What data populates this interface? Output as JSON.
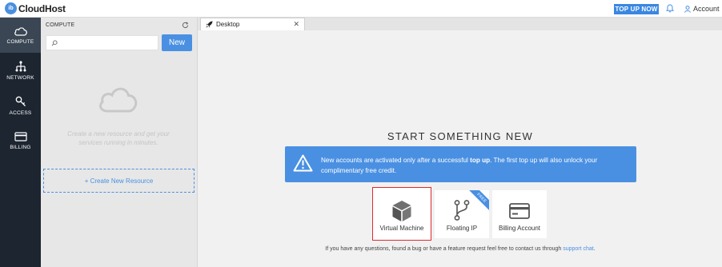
{
  "app": {
    "logo_mark": "ib",
    "name": "CloudHost"
  },
  "header": {
    "topup_label": "TOP UP NOW",
    "account_label": "Account",
    "icons": [
      "bell-icon",
      "user-icon"
    ]
  },
  "sidenav": {
    "items": [
      {
        "label": "COMPUTE",
        "icon": "cloud-icon",
        "active": true
      },
      {
        "label": "NETWORK",
        "icon": "network-icon",
        "active": false
      },
      {
        "label": "ACCESS",
        "icon": "key-icon",
        "active": false
      },
      {
        "label": "BILLING",
        "icon": "credit-card-icon",
        "active": false
      }
    ]
  },
  "panel": {
    "title": "COMPUTE",
    "search_placeholder": "",
    "search_value": "",
    "new_label": "New",
    "empty_text": "Create a new resource and get your services running in minutes.",
    "create_label": "+ Create New Resource"
  },
  "tabs": [
    {
      "label": "Desktop",
      "icon": "rocket-icon",
      "close": "✕"
    }
  ],
  "desktop": {
    "headline": "START SOMETHING NEW",
    "banner_pre": "New accounts are activated only after a successful ",
    "banner_bold": "top up",
    "banner_post": ". The first top up will also unlock your complimentary free credit.",
    "cards": [
      {
        "label": "Virtual Machine",
        "icon": "cube-icon",
        "selected": true
      },
      {
        "label": "Floating IP",
        "icon": "fork-icon",
        "ribbon": "FREE"
      },
      {
        "label": "Billing Account",
        "icon": "credit-card-icon"
      }
    ],
    "footer_pre": "If you have any questions, found a bug or have a feature request feel free to contact us through ",
    "footer_link": "support chat",
    "footer_post": "."
  },
  "colors": {
    "accent": "#4a90e2",
    "sidebar": "#1c2530",
    "selected_border": "#e02a2a"
  }
}
